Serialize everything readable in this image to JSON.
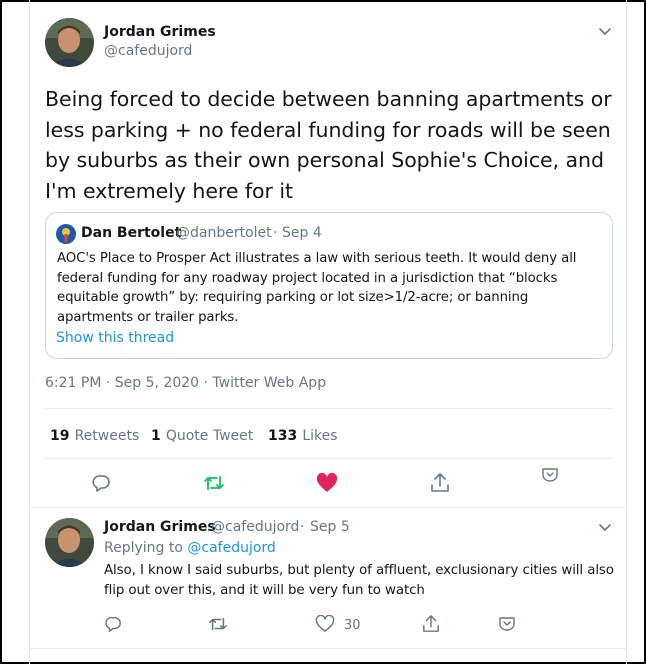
{
  "tweet": {
    "author_name": "Jordan Grimes",
    "author_handle": "@cafedujord",
    "text": "Being forced to decide between banning apartments or less parking + no federal funding for roads will be seen by suburbs as their own personal Sophie's Choice, and I'm extremely here for it",
    "quoted": {
      "author_name": "Dan Bertolet",
      "author_handle": "@danbertolet",
      "date": "Sep 4",
      "text": "AOC's Place to Prosper Act illustrates a law with serious teeth. It would deny all federal funding for any roadway project located in a jurisdiction that “blocks equitable growth” by: requiring parking or lot size>1/2-acre; or banning apartments or trailer parks.",
      "show_thread": "Show this thread"
    },
    "timestamp": "6:21 PM · Sep 5, 2020 · Twitter Web App",
    "stats": {
      "retweets_count": "19",
      "retweets_label": "Retweets",
      "quotes_count": "1",
      "quotes_label": "Quote Tweet",
      "likes_count": "133",
      "likes_label": "Likes"
    },
    "liked": true
  },
  "reply": {
    "author_name": "Jordan Grimes",
    "author_handle": "@cafedujord",
    "date": "Sep 5",
    "replying_prefix": "Replying to",
    "replying_handle": "@cafedujord",
    "text": "Also, I know I said suburbs, but plenty of affluent, exclusionary cities will also flip out over this, and it will be very fun to watch",
    "likes_count": "30"
  },
  "colors": {
    "text": "#14171a",
    "muted": "#657786",
    "link": "#1b95e0",
    "retweet_green": "#17bf63",
    "like_red": "#e0245e",
    "border": "#e6ecf0"
  },
  "icons": [
    "chevron-down-icon",
    "reply-icon",
    "retweet-icon",
    "heart-icon",
    "share-icon",
    "bookmark-icon",
    "sun-avatar-icon"
  ]
}
